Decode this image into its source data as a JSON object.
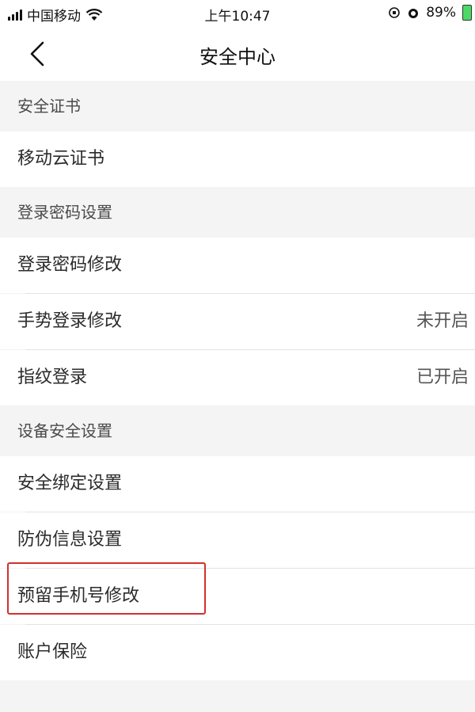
{
  "status_bar": {
    "carrier": "中国移动",
    "time": "上午10:47",
    "battery": "89%"
  },
  "nav": {
    "title": "安全中心"
  },
  "sections": [
    {
      "header": "安全证书",
      "items": [
        {
          "label": "移动云证书",
          "value": ""
        }
      ]
    },
    {
      "header": "登录密码设置",
      "items": [
        {
          "label": "登录密码修改",
          "value": ""
        },
        {
          "label": "手势登录修改",
          "value": "未开启"
        },
        {
          "label": "指纹登录",
          "value": "已开启"
        }
      ]
    },
    {
      "header": "设备安全设置",
      "items": [
        {
          "label": "安全绑定设置",
          "value": ""
        },
        {
          "label": "防伪信息设置",
          "value": ""
        },
        {
          "label": "预留手机号修改",
          "value": ""
        },
        {
          "label": "账户保险",
          "value": ""
        }
      ]
    }
  ],
  "colors": {
    "highlight": "#d0312d",
    "battery": "#4cd964"
  }
}
